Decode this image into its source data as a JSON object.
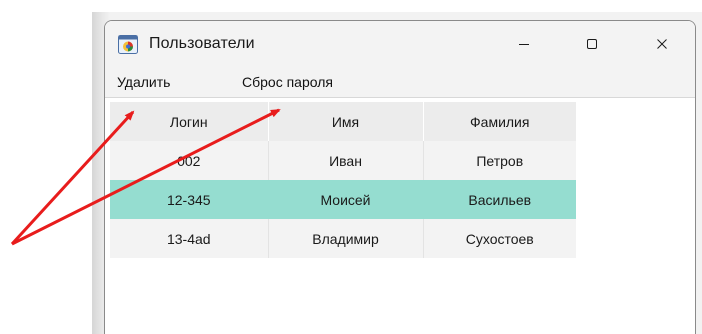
{
  "window": {
    "title": "Пользователи",
    "icon": "app-icon",
    "controls": [
      "minimize-icon",
      "maximize-icon",
      "close-icon"
    ]
  },
  "menu": {
    "items": [
      {
        "label": "Удалить"
      },
      {
        "label": "Сброс пароля"
      }
    ]
  },
  "table": {
    "headers": [
      "Логин",
      "Имя",
      "Фамилия"
    ],
    "rows": [
      {
        "login": "002",
        "name": "Иван",
        "surname": "Петров",
        "selected": false
      },
      {
        "login": "12-345",
        "name": "Моисей",
        "surname": "Васильев",
        "selected": true
      },
      {
        "login": "13-4ad",
        "name": "Владимир",
        "surname": "Сухостоев",
        "selected": false
      }
    ]
  },
  "colors": {
    "selection": "#95ddd0",
    "annotation_arrows": "#e81c1c",
    "titlebar": "#f3f3f3"
  }
}
